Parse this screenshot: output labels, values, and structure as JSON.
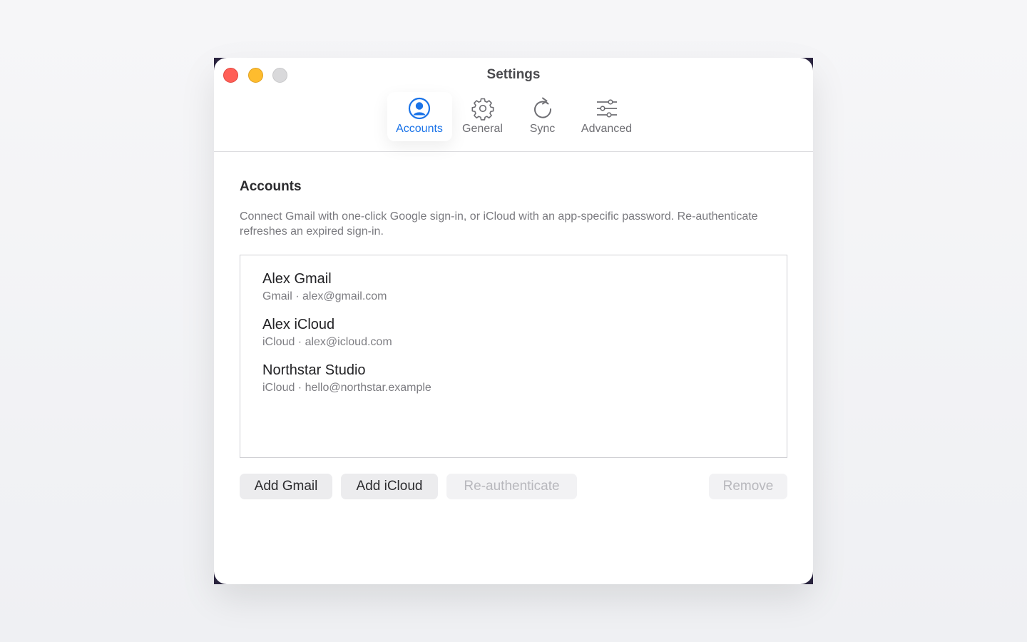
{
  "window": {
    "title": "Settings"
  },
  "tabs": [
    {
      "label": "Accounts",
      "icon": "person-circle-icon",
      "active": true
    },
    {
      "label": "General",
      "icon": "gear-icon",
      "active": false
    },
    {
      "label": "Sync",
      "icon": "refresh-icon",
      "active": false
    },
    {
      "label": "Advanced",
      "icon": "sliders-icon",
      "active": false
    }
  ],
  "accounts": {
    "title": "Accounts",
    "description": "Connect Gmail with one-click Google sign-in, or iCloud with an app-specific password. Re-authenticate refreshes an expired sign-in.",
    "items": [
      {
        "name": "Alex Gmail",
        "detail": "Gmail · alex@gmail.com"
      },
      {
        "name": "Alex iCloud",
        "detail": "iCloud · alex@icloud.com"
      },
      {
        "name": "Northstar Studio",
        "detail": "iCloud · hello@northstar.example"
      }
    ],
    "buttons": {
      "add_gmail": "Add Gmail",
      "add_icloud": "Add iCloud",
      "reauthenticate": "Re-authenticate",
      "remove": "Remove"
    }
  },
  "colors": {
    "accent": "#1a73e8",
    "close": "#ff5f57",
    "minimize": "#febc2e",
    "zoom_disabled": "#d9d9db"
  }
}
